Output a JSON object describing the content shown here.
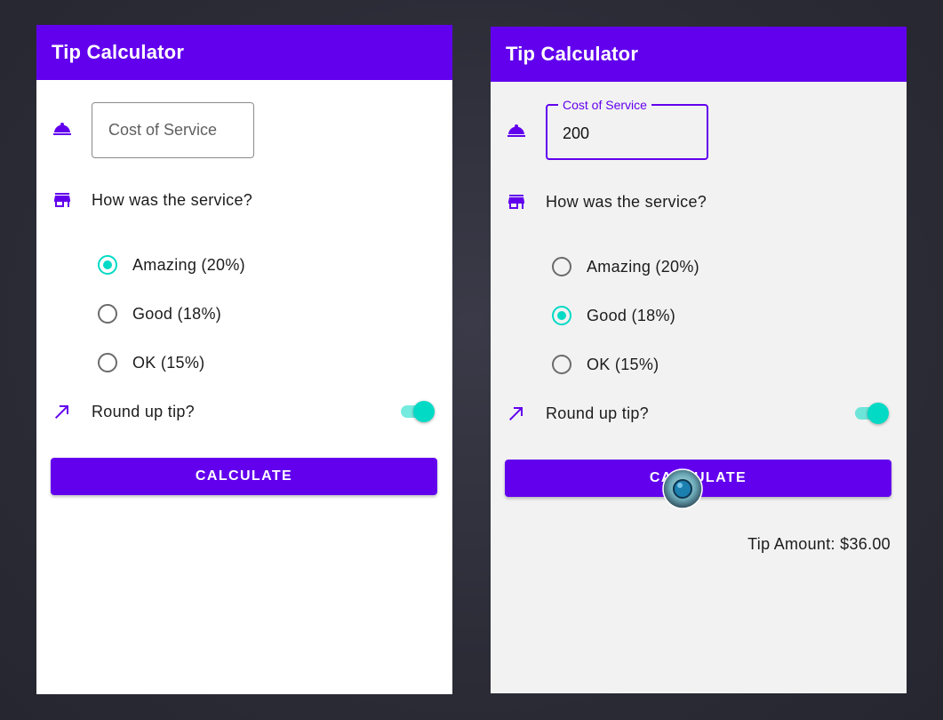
{
  "colors": {
    "primary": "#6200ee",
    "secondary": "#03dac5",
    "background_dark": "#2c2c37"
  },
  "screens": [
    {
      "app_title": "Tip Calculator",
      "cost_field": {
        "placeholder": "Cost of Service",
        "value": ""
      },
      "service_question": "How was the service?",
      "options": [
        {
          "label": "Amazing (20%)",
          "checked": true
        },
        {
          "label": "Good (18%)",
          "checked": false
        },
        {
          "label": "OK (15%)",
          "checked": false
        }
      ],
      "round_up_label": "Round up tip?",
      "round_up_on": true,
      "calculate_label": "CALCULATE",
      "result": ""
    },
    {
      "app_title": "Tip Calculator",
      "cost_field": {
        "label": "Cost of Service",
        "value": "200"
      },
      "service_question": "How was the service?",
      "options": [
        {
          "label": "Amazing (20%)",
          "checked": false
        },
        {
          "label": "Good (18%)",
          "checked": true
        },
        {
          "label": "OK (15%)",
          "checked": false
        }
      ],
      "round_up_label": "Round up tip?",
      "round_up_on": true,
      "calculate_label": "CALCULATE",
      "result": "Tip Amount: $36.00"
    }
  ],
  "icons": {
    "cost": "room-service-icon",
    "service": "storefront-icon",
    "round_up": "trending-up-arrow-icon",
    "touch": "touch-indicator-icon"
  }
}
